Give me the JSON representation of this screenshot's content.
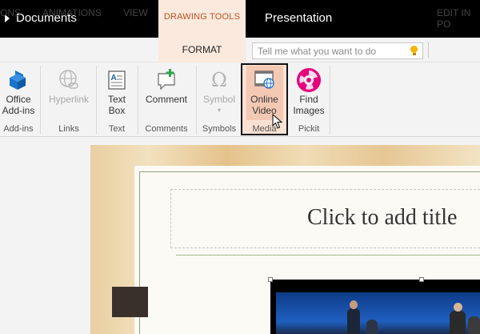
{
  "titlebar": {
    "doc_label": "Documents",
    "context_label": "DRAWING TOOLS",
    "presentation_label": "Presentation"
  },
  "tabs": {
    "items": [
      "ONS",
      "ANIMATIONS",
      "VIEW"
    ],
    "active": "FORMAT",
    "right": "EDIT IN PO"
  },
  "search": {
    "placeholder": "Tell me what you want to do"
  },
  "ribbon": {
    "buttons": [
      {
        "label1": "Office",
        "label2": "Add-ins",
        "icon": "office-addins-icon"
      },
      {
        "label1": "Hyperlink",
        "label2": "",
        "icon": "hyperlink-icon",
        "disabled": true
      },
      {
        "label1": "Text",
        "label2": "Box",
        "icon": "textbox-icon"
      },
      {
        "label1": "Comment",
        "label2": "",
        "icon": "comment-icon"
      },
      {
        "label1": "Symbol",
        "label2": "",
        "icon": "omega-icon",
        "disabled": true
      },
      {
        "label1": "Online",
        "label2": "Video",
        "icon": "online-video-icon"
      },
      {
        "label1": "Find",
        "label2": "Images",
        "icon": "pickit-icon"
      }
    ],
    "groups": [
      "Add-ins",
      "Links",
      "Text",
      "Comments",
      "Symbols",
      "Media",
      "Pickit"
    ]
  },
  "slide": {
    "title_placeholder": "Click to add title"
  },
  "colors": {
    "accent": "#c8501e",
    "pickit": "#e6007e",
    "office_blue": "#1a73c8"
  }
}
